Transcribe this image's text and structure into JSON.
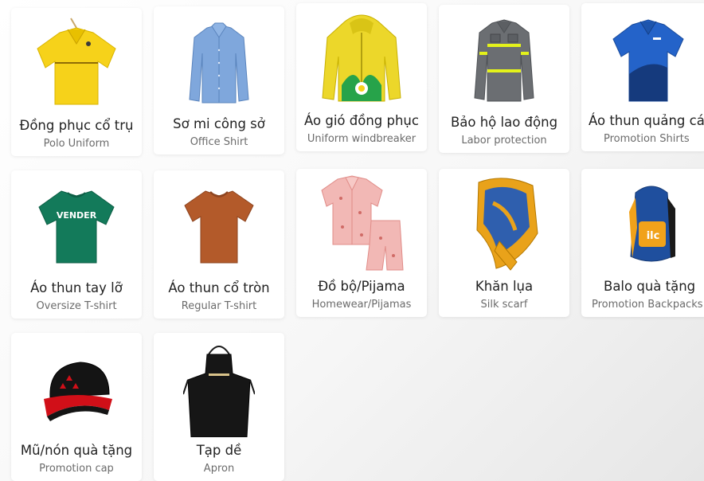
{
  "products": [
    {
      "title": "Đồng phục cổ trụ",
      "subtitle": "Polo Uniform",
      "icon": "polo-shirt-icon"
    },
    {
      "title": "Sơ mi công sở",
      "subtitle": "Office Shirt",
      "icon": "office-shirt-icon"
    },
    {
      "title": "Áo gió đồng phục",
      "subtitle": "Uniform windbreaker",
      "icon": "windbreaker-icon"
    },
    {
      "title": "Bảo hộ lao động",
      "subtitle": "Labor protection",
      "icon": "work-shirt-icon"
    },
    {
      "title": "Áo thun quảng cáo",
      "subtitle": "Promotion Shirts",
      "icon": "promo-polo-icon"
    },
    {
      "title": "Áo thun tay lỡ",
      "subtitle": "Oversize T-shirt",
      "icon": "oversize-tshirt-icon",
      "print": "VENDER"
    },
    {
      "title": "Áo thun cổ tròn",
      "subtitle": "Regular T-shirt",
      "icon": "tshirt-icon"
    },
    {
      "title": "Đồ bộ/Pijama",
      "subtitle": "Homewear/Pijamas",
      "icon": "pajamas-icon"
    },
    {
      "title": "Khăn lụa",
      "subtitle": "Silk scarf",
      "icon": "scarf-icon"
    },
    {
      "title": "Balo quà tặng",
      "subtitle": "Promotion Backpacks",
      "icon": "backpack-icon",
      "print": "ilc"
    },
    {
      "title": "Mũ/nón quà tặng",
      "subtitle": "Promotion cap",
      "icon": "cap-icon"
    },
    {
      "title": "Tạp dề",
      "subtitle": "Apron",
      "icon": "apron-icon"
    }
  ]
}
